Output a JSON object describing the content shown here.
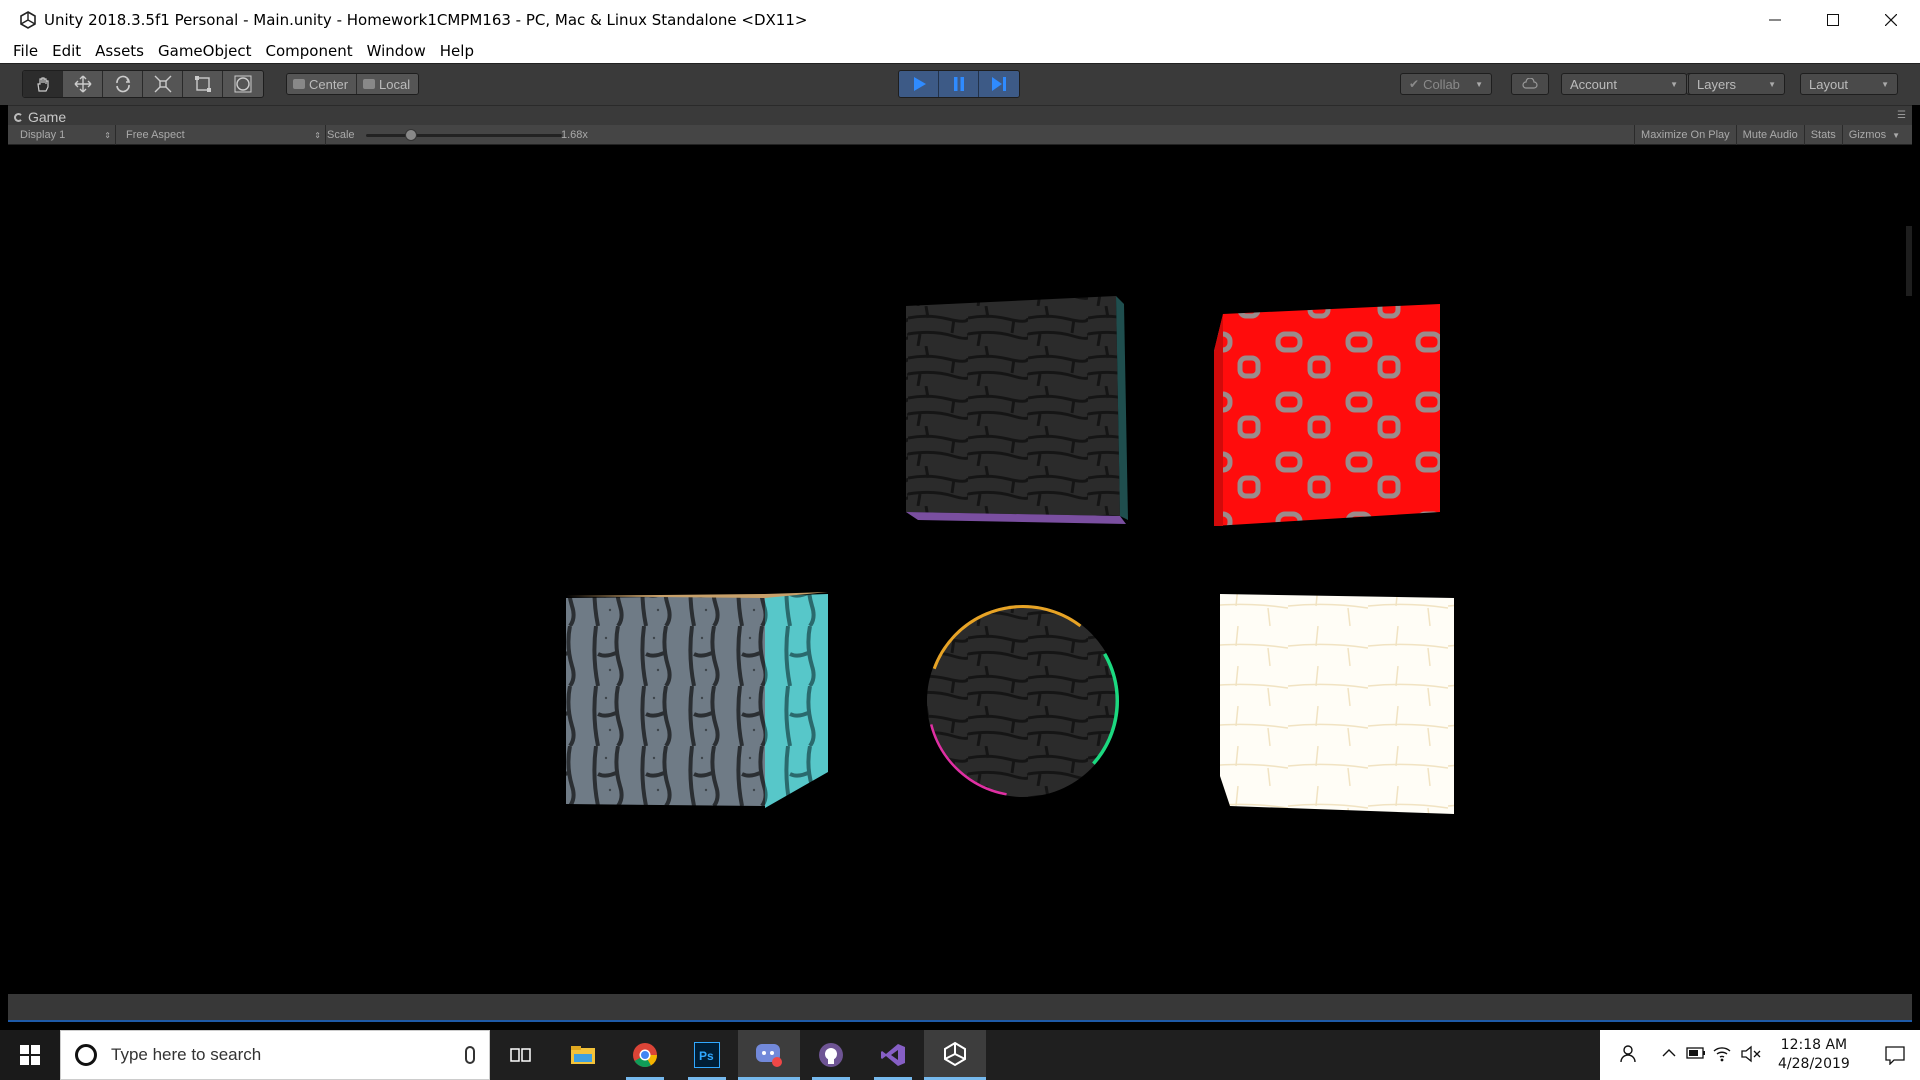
{
  "window": {
    "title": "Unity 2018.3.5f1 Personal - Main.unity - Homework1CMPM163 - PC, Mac & Linux Standalone <DX11>"
  },
  "menu": [
    "File",
    "Edit",
    "Assets",
    "GameObject",
    "Component",
    "Window",
    "Help"
  ],
  "toolbar": {
    "tools": [
      "hand-tool-icon",
      "move-tool-icon",
      "rotate-tool-icon",
      "scale-tool-icon",
      "rect-tool-icon",
      "transform-tool-icon"
    ],
    "pivot_label": "Center",
    "space_label": "Local",
    "collab_label": "Collab",
    "account_label": "Account",
    "layers_label": "Layers",
    "layout_label": "Layout"
  },
  "game": {
    "tab_label": "Game",
    "display_label": "Display 1",
    "aspect_label": "Free Aspect",
    "scale_label": "Scale",
    "scale_value_label": "1.68x",
    "maximize_label": "Maximize On Play",
    "mute_label": "Mute Audio",
    "stats_label": "Stats",
    "gizmos_label": "Gizmos"
  },
  "taskbar": {
    "search_placeholder": "Type here to search",
    "time": "12:18 AM",
    "date": "4/28/2019",
    "apps": [
      "task-view-icon",
      "file-explorer-icon",
      "chrome-icon",
      "photoshop-icon",
      "discord-icon",
      "github-icon",
      "visual-studio-icon",
      "unity-icon"
    ]
  },
  "colors": {
    "editor_dark": "#3a3a3a",
    "play_blue": "#3d5a86",
    "accent_blue": "#76b9ed"
  }
}
